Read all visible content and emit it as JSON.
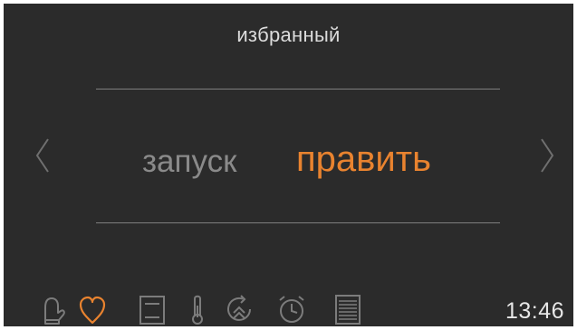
{
  "header": {
    "title": "избранный"
  },
  "menu": {
    "options": [
      "запуск",
      "править"
    ],
    "selected": "править"
  },
  "colors": {
    "background": "#2b2b2b",
    "accent": "#e9832f",
    "inactive": "#8a8a8a",
    "icon": "#7c7c7c"
  },
  "toolbar": {
    "icons": [
      "oven-mitt-icon",
      "heart-icon",
      "panel-icon",
      "thermometer-icon",
      "cycle-icon",
      "alarm-clock-icon",
      "list-icon"
    ],
    "active_icon": "heart-icon"
  },
  "status": {
    "time": "13:46"
  }
}
